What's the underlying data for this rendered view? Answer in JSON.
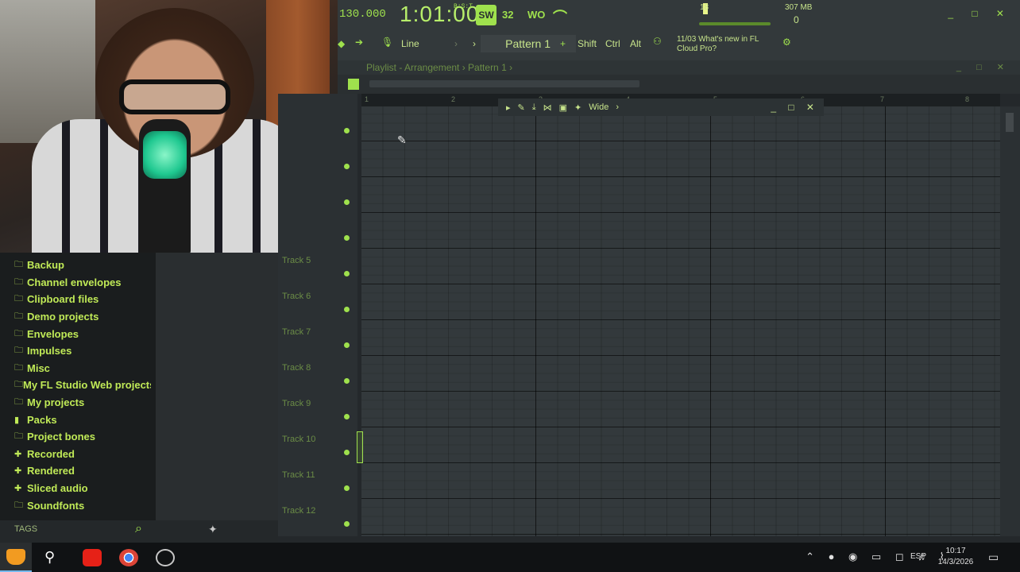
{
  "toolbar": {
    "tempo": "130.000",
    "time": "1:01:00",
    "time_sub": "B:S:T",
    "song_mode": "SW",
    "btn_32": "32",
    "btn_wo": "WO",
    "btn_wave": "⌒",
    "cpu": "18",
    "memory": "307 MB",
    "mem_zero": "0",
    "window_controls": "_ □ ✕",
    "snap_mode": "Line",
    "pattern": "Pattern 1",
    "plus": "+",
    "shift": "Shift",
    "ctrl": "Ctrl",
    "alt": "Alt",
    "news_date": "11/03",
    "news_text": "What's new in FL Cloud Pro?"
  },
  "playlist": {
    "title": "Playlist - Arrangement › Pattern 1 ›",
    "title_controls": "_ □ ✕",
    "ruler": [
      "1",
      "2",
      "3",
      "4",
      "5",
      "6",
      "7",
      "8"
    ],
    "tracks": [
      "Track 5",
      "Track 6",
      "Track 7",
      "Track 8",
      "Track 9",
      "Track 10",
      "Track 11",
      "Track 12"
    ],
    "float_tool": "Wide",
    "float_controls": "_ □ ✕"
  },
  "browser": {
    "items": [
      {
        "label": "Backup",
        "icon": "folder-icon"
      },
      {
        "label": "Channel envelopes",
        "icon": "folder-icon"
      },
      {
        "label": "Clipboard files",
        "icon": "folder-icon"
      },
      {
        "label": "Demo projects",
        "icon": "folder-icon"
      },
      {
        "label": "Envelopes",
        "icon": "folder-icon"
      },
      {
        "label": "Impulses",
        "icon": "folder-icon"
      },
      {
        "label": "Misc",
        "icon": "folder-icon"
      },
      {
        "label": "My FL Studio Web projects",
        "icon": "folder-icon"
      },
      {
        "label": "My projects",
        "icon": "folder-icon"
      },
      {
        "label": "Packs",
        "icon": "pack-icon"
      },
      {
        "label": "Project bones",
        "icon": "folder-icon"
      },
      {
        "label": "Recorded",
        "icon": "plus-icon"
      },
      {
        "label": "Rendered",
        "icon": "plus-icon"
      },
      {
        "label": "Sliced audio",
        "icon": "plus-icon"
      },
      {
        "label": "Soundfonts",
        "icon": "folder-icon"
      }
    ],
    "tags": "TAGS"
  },
  "taskbar": {
    "language": "ESP",
    "time": "10:17",
    "date": "14/3/2026"
  },
  "colors": {
    "accent": "#9fe14d",
    "panel": "#33393b",
    "grid": "#33393c"
  }
}
